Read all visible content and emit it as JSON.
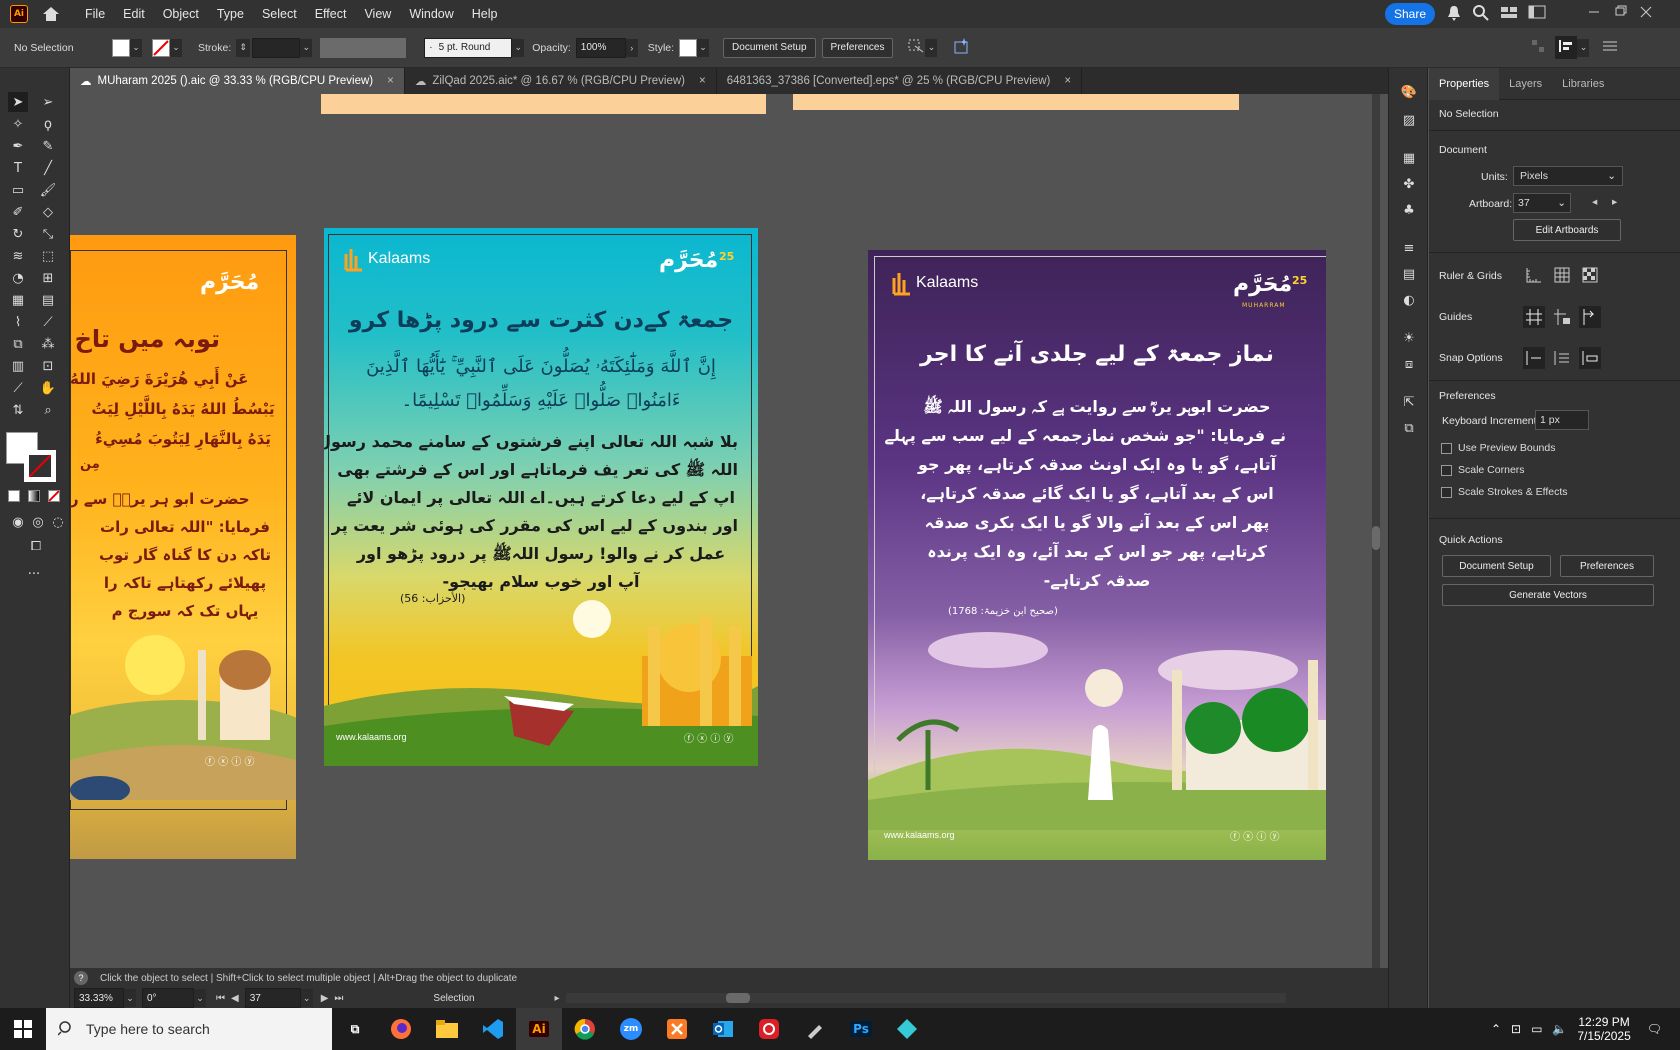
{
  "app": {
    "logo": "Ai",
    "menus": [
      "File",
      "Edit",
      "Object",
      "Type",
      "Select",
      "Effect",
      "View",
      "Window",
      "Help"
    ],
    "share": "Share"
  },
  "control": {
    "selection": "No Selection",
    "stroke_label": "Stroke:",
    "brush": "5 pt. Round",
    "opacity_label": "Opacity:",
    "opacity": "100%",
    "style_label": "Style:",
    "document_setup": "Document Setup",
    "preferences": "Preferences"
  },
  "tabs": [
    {
      "label": "MUharam 2025 ().aic @ 33.33 % (RGB/CPU Preview)",
      "close": "×"
    },
    {
      "label": "ZilQad 2025.aic* @ 16.67 % (RGB/CPU Preview)",
      "close": "×"
    },
    {
      "label": "6481363_37386 [Converted].eps* @ 25 % (RGB/CPU Preview)",
      "close": "×"
    }
  ],
  "artboards": {
    "left": {
      "heading": "توبہ میں تاخ",
      "arabic1": "عَنْ أَبِي هُرَيْرَةَ رَضِيَ اللهُ",
      "arabic2": "يَبْسُطُ اللهُ يَدَهُ بِاللَّيْلِ لِيَتُ",
      "arabic3": "يَدَهُ بِالنَّهَارِ لِيَتُوبَ مُسِيءُ",
      "arabic4": "مِن",
      "body": [
        "حضرت ابو ہر یرہؓ سے ر",
        "فرمایا: \"اللہ تعالی رات",
        "تاکہ دن کا گناہ گار توب",
        "پھیلائے رکھتاہے تاکہ را",
        "یہاں تک کہ سورج م"
      ]
    },
    "middle": {
      "brand": "Kalaams",
      "logo_text": "مُحَرَّم",
      "logo_num": "25",
      "heading": "جمعۃ کےدن کثرت سے درود پڑھا کرو",
      "arabic1": "إِنَّ ٱللَّهَ وَمَلَٰٓئِكَتَهُۥ يُصَلُّونَ عَلَى ٱلنَّبِيِّ ۚ يَٰٓأَيُّهَا ٱلَّذِينَ",
      "arabic2": "ءَامَنُوا۟ صَلُّوا۟ عَلَيْهِ وَسَلِّمُوا۟ تَسْلِيمًا۔",
      "body": [
        "بلا شبہ اللہ تعالی اپنے فرشتوں کے سامنے محمد رسول",
        "اللہ ﷺ کی تعر یف فرماتاہے اور اس کے فرشتے بھی",
        "اپ کے لیے دعا کرتے ہیں۔اے اللہ تعالی پر ایمان لائے",
        "اور بندوں کے لیے اس کی مقرر کی ہوئی شر یعت پر",
        "عمل کر نے والو! رسول اللہﷺ پر درود پڑھو اور",
        "آپ اور خوب سلام بھیجو-"
      ],
      "ref": "(الأحزاب: 56)",
      "website": "www.kalaams.org"
    },
    "right": {
      "brand": "Kalaams",
      "logo_text": "مُحَرَّم",
      "logo_num": "25",
      "logo_sub": "MUHARRAM",
      "heading": "نماز جمعۃ کے لیے جلدی آنے کا اجر",
      "body": [
        "حضرت ابوہر یرہؓ سے روایت ہے کہ رسول اللہ ﷺ",
        "نے فرمایا: \"جو شخص نمازجمعہ کے لیے سب سے پہلے",
        "آتاہے، گو یا وہ ایک اونٹ صدقہ کرتاہے، پھر جو",
        "اس کے بعد آتاہے، گو یا ایک گائے صدقہ کرتاہے،",
        "پھر اس کے بعد آنے والا گو یا ایک بکری صدقہ",
        "کرتاہے، پھر جو اس کے بعد آئے، وہ ایک پرندہ",
        "صدقہ کرتاہے-"
      ],
      "ref": "(صحیح ابن خزیمۃ: 1768)",
      "website": "www.kalaams.org"
    }
  },
  "panel": {
    "tabs": [
      "Properties",
      "Layers",
      "Libraries"
    ],
    "selection": "No Selection",
    "document": "Document",
    "units_label": "Units:",
    "units": "Pixels",
    "artboard_label": "Artboard:",
    "artboard": "37",
    "edit_artboards": "Edit Artboards",
    "rulers": "Ruler & Grids",
    "guides": "Guides",
    "snap": "Snap Options",
    "preferences": "Preferences",
    "kbd_label": "Keyboard Increment:",
    "kbd": "1 px",
    "cb1": "Use Preview Bounds",
    "cb2": "Scale Corners",
    "cb3": "Scale Strokes & Effects",
    "quick": "Quick Actions",
    "doc_setup": "Document Setup",
    "prefs_btn": "Preferences",
    "gen_vectors": "Generate Vectors"
  },
  "status": {
    "hint": "Click the object to select  |  Shift+Click to select multiple object  |  Alt+Drag the object to duplicate",
    "zoom": "33.33%",
    "rotate": "0°",
    "artboard": "37",
    "tool": "Selection"
  },
  "taskbar": {
    "search": "Type here to search",
    "time": "12:29 PM",
    "date": "7/15/2025",
    "apps": [
      "Ai",
      "Ps",
      "zm"
    ]
  }
}
